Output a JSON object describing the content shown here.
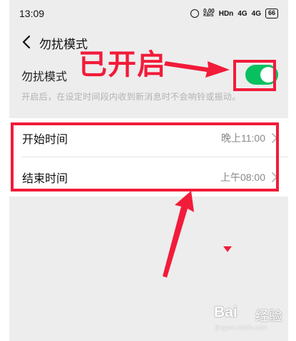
{
  "status_bar": {
    "time": "13:09",
    "speed_value": "0.00",
    "speed_unit": "KB/S",
    "hd_label": "HDn",
    "signal1": "4G",
    "signal2": "4G",
    "battery": "66"
  },
  "nav": {
    "title": "勿扰模式"
  },
  "dnd": {
    "label": "勿扰模式",
    "description": "开启后，在设定时间段内收到新消息时不会响铃或振动。",
    "enabled": true,
    "toggle_color": "#07c160"
  },
  "time_rows": [
    {
      "label": "开始时间",
      "value": "晚上11:00"
    },
    {
      "label": "结束时间",
      "value": "上午08:00"
    }
  ],
  "annotation": {
    "text": "已开启",
    "color": "#f21b3a"
  },
  "watermark": {
    "brand": "Bai",
    "suffix": "经验",
    "url": "jingyan.baidu.com"
  }
}
